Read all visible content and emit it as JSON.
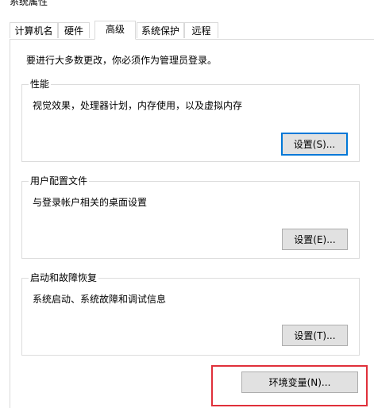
{
  "window": {
    "title": "系统属性"
  },
  "tabs": [
    {
      "label": "计算机名"
    },
    {
      "label": "硬件"
    },
    {
      "label": "高级",
      "active": true
    },
    {
      "label": "系统保护"
    },
    {
      "label": "远程"
    }
  ],
  "main": {
    "admin_notice": "要进行大多数更改，你必须作为管理员登录。"
  },
  "groups": {
    "performance": {
      "title": "性能",
      "description": "视觉效果，处理器计划，内存使用，以及虚拟内存",
      "button_label": "设置(S)..."
    },
    "user_profiles": {
      "title": "用户配置文件",
      "description": "与登录帐户相关的桌面设置",
      "button_label": "设置(E)..."
    },
    "startup_recovery": {
      "title": "启动和故障恢复",
      "description": "系统启动、系统故障和调试信息",
      "button_label": "设置(T)..."
    }
  },
  "env_button": {
    "label": "环境变量(N)..."
  },
  "colors": {
    "highlight_border": "#e0303a",
    "focus_border": "#0078d7",
    "button_face": "#e1e1e1"
  }
}
